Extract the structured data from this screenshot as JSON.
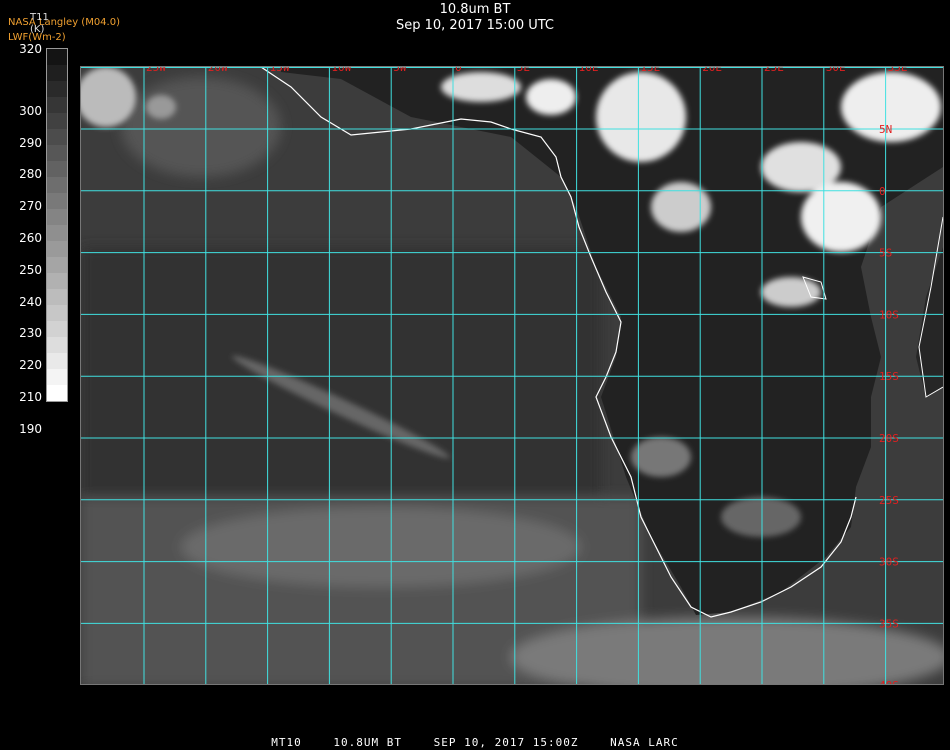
{
  "header": {
    "title": "10.8um BT",
    "subtitle": "Sep 10, 2017 15:00 UTC",
    "org_line": "NASA Langley (M04.0)",
    "unit_line": "LWF(Wm-2)"
  },
  "colorbar": {
    "title": "T11",
    "unit": "(K)",
    "labels": [
      "320",
      "300",
      "290",
      "280",
      "270",
      "260",
      "250",
      "240",
      "230",
      "220",
      "210",
      "190"
    ]
  },
  "map": {
    "lon_labels": [
      "25W",
      "20W",
      "15W",
      "10W",
      "5W",
      "0",
      "5E",
      "10E",
      "15E",
      "20E",
      "25E",
      "30E",
      "35E"
    ],
    "lat_labels": [
      "5N",
      "0",
      "5S",
      "10S",
      "15S",
      "20S",
      "25S",
      "30S",
      "35S",
      "40S"
    ],
    "colors": {
      "grid": "#40e0e0",
      "label": "#e02020",
      "coast": "#ffffff"
    }
  },
  "footer": {
    "product": "MT10",
    "channel": "10.8UM BT",
    "datetime": "SEP 10, 2017 15:00Z",
    "org": "NASA LARC"
  }
}
